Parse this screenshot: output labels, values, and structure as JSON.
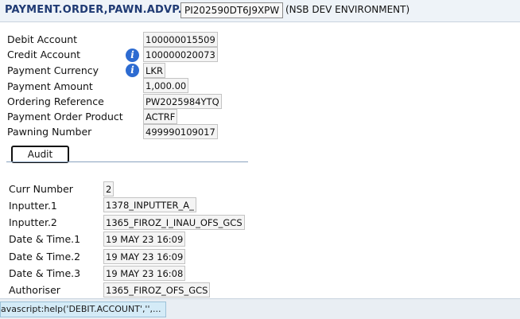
{
  "header": {
    "title": "PAYMENT.ORDER,PAWN.ADVP.NSB",
    "record_id": "PI202590DT6J9XPW",
    "environment": "(NSB DEV ENVIRONMENT)"
  },
  "fields": [
    {
      "label": "Debit Account",
      "value": "100000015509",
      "info": false
    },
    {
      "label": "Credit Account",
      "value": "100000020073",
      "info": true
    },
    {
      "label": "Payment Currency",
      "value": "LKR",
      "info": true
    },
    {
      "label": "Payment Amount",
      "value": "1,000.00",
      "info": false
    },
    {
      "label": "Ordering Reference",
      "value": "PW2025984YTQ",
      "info": false
    },
    {
      "label": "Payment Order Product",
      "value": "ACTRF",
      "info": false
    },
    {
      "label": "Pawning Number",
      "value": "499990109017",
      "info": false
    }
  ],
  "audit_tab": {
    "label": "Audit"
  },
  "audit_fields": [
    {
      "label": "Curr Number",
      "value": "2"
    },
    {
      "label": "Inputter.1",
      "value": "1378_INPUTTER_A_"
    },
    {
      "label": "Inputter.2",
      "value": "1365_FIROZ_I_INAU_OFS_GCS"
    },
    {
      "label": "Date & Time.1",
      "value": "19 MAY 23 16:09"
    },
    {
      "label": "Date & Time.2",
      "value": "19 MAY 23 16:09"
    },
    {
      "label": "Date & Time.3",
      "value": "19 MAY 23 16:08"
    },
    {
      "label": "Authoriser",
      "value": "1365_FIROZ_OFS_GCS"
    }
  ],
  "status_bar": {
    "text": "avascript:help('DEBIT.ACCOUNT','',..."
  },
  "icons": {
    "info": "info-icon"
  },
  "colors": {
    "title": "#1f3a73",
    "info": "#2d6bd1",
    "status_bg": "#d4ebf7"
  }
}
